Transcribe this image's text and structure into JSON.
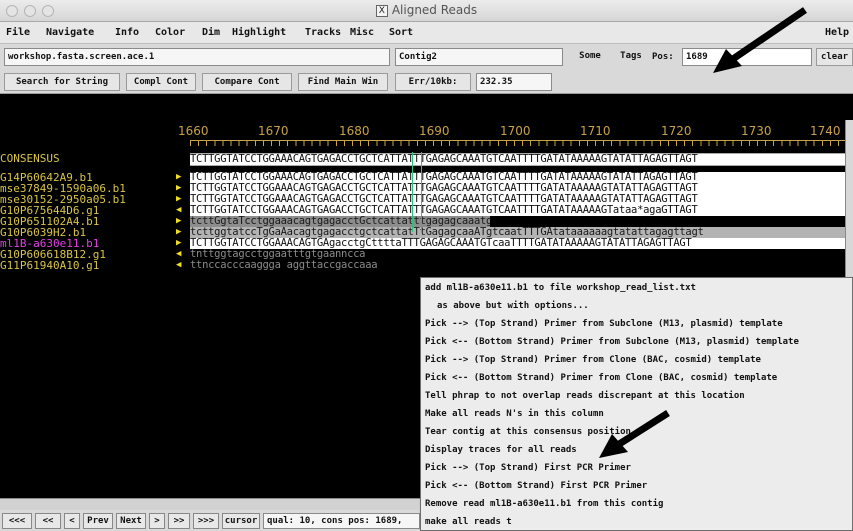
{
  "window": {
    "title": "Aligned Reads",
    "title_icon": "X"
  },
  "menu": [
    "File",
    "Navigate",
    "Info",
    "Color",
    "Dim",
    "Highlight",
    "Tracks",
    "Misc",
    "Sort",
    "Help"
  ],
  "toolbar1": {
    "filename": "workshop.fasta.screen.ace.1",
    "contig": "Contig2",
    "some_label": "Some",
    "tags_label": "Tags",
    "pos_label": "Pos:",
    "pos_value": "1689",
    "clear_label": "clear"
  },
  "toolbar2": {
    "search": "Search for String",
    "compl": "Compl Cont",
    "compare": "Compare Cont",
    "find_main": "Find Main Win",
    "err_label": "Err/10kb:",
    "err_value": "232.35"
  },
  "ruler": [
    "1660",
    "1670",
    "1680",
    "1690",
    "1700",
    "1710",
    "1720",
    "1730",
    "1740"
  ],
  "consensus": {
    "name": "CONSENSUS",
    "seq": "TCTTGGTATCCTGGAAACAGTGAGACCTGCTCATTATTTGAGAGCAAATGTCAATTTTGATATAAAAAGTATATTAGAGTTAGT"
  },
  "reads": [
    {
      "name": "G14P60642A9.b1",
      "dir": "▶",
      "seq": "TCTTGGTATCCTGGAAACAGTGAGACCTGCTCATTATTTGAGAGCAAATGTCAATTTTGATATAAAAAGTATATTAGAGTTAGT"
    },
    {
      "name": "mse37849-1590a06.b1",
      "dir": "▶",
      "seq": "TCTTGGTATCCTGGAAACAGTGAGACCTGCTCATTATTTGAGAGCAAATGTCAATTTTGATATAAAAAGTATATTAGAGTTAGT"
    },
    {
      "name": "mse30152-2950a05.b1",
      "dir": "▶",
      "seq": "TCTTGGTATCCTGGAAACAGTGAGACCTGCTCATTATTTGAGAGCAAATGTCAATTTTGATATAAAAAGTATATTAGAGTTAGT"
    },
    {
      "name": "G10P675644D6.g1",
      "dir": "◀",
      "seq": "TCTTGGTATCCTGGAAACAGTGAGACCTGCTCATTATTTGAGAGCAAATGTCAATTTTGATATAAAAAGTataa*agaGTTAGT"
    },
    {
      "name": "G10P651102A4.b1",
      "dir": "▶",
      "seq": "tcttGgtaTcctggaaacagtgagacctGctcattatttgagagcaaatgtcan"
    },
    {
      "name": "G10P6039H2.b1",
      "dir": "▶",
      "seq": "tcttggtatccTgGaAacagtgagacctgctcattatTtGagagcaaATgtcaatTTTGAtataaaaaagtatattagagttagt"
    },
    {
      "name": "ml1B-a630e11.b1",
      "dir": "▶",
      "seq": "TCTTGGTATCCTGGAAACAGTGAgacctgCttttaTTTGAGAGCAAATGTcaaTTTTGATATAAAAAGTATATTAGAGTTAGT"
    },
    {
      "name": "G10P606618B12.g1",
      "dir": "◀",
      "seq": "tnttggtagcctggaatttgtgaanncca"
    },
    {
      "name": "G11P61940A10.g1",
      "dir": "◀",
      "seq": "ttnccacccaaggga aggttaccgaccaaa"
    }
  ],
  "context_menu": [
    "add ml1B-a630e11.b1 to file workshop_read_list.txt",
    "   as above but with options...",
    "Pick --> (Top Strand) Primer from Subclone (M13, plasmid) template",
    "Pick <-- (Bottom Strand) Primer from Subclone (M13, plasmid) template",
    "Pick --> (Top Strand) Primer from Clone (BAC, cosmid) template",
    "Pick <-- (Bottom Strand) Primer from Clone (BAC, cosmid) template",
    "Tell phrap to not overlap reads discrepant at this location",
    "Make all reads N's in this column",
    "Tear contig at this consensus position",
    "Display traces for all reads",
    "Pick --> (Top Strand) First PCR Primer",
    "Pick <-- (Bottom Strand) First PCR Primer",
    "Remove read ml1B-a630e11.b1 from this contig",
    "make all reads t"
  ],
  "bottom": {
    "nav": [
      "<<<",
      "<<",
      "<",
      "Prev",
      "Next",
      ">",
      ">>",
      ">>>",
      "cursor"
    ],
    "status": "qual: 10, cons pos: 1689,"
  },
  "colors": {
    "ruler": "#c8a24a",
    "consensus_name": "#d8c34a",
    "read_name": "#d8c34a",
    "highlight_read": "#e040e0",
    "arrow": "#f0e020",
    "column_marker": "#29c27a",
    "annotation": "#000000"
  }
}
